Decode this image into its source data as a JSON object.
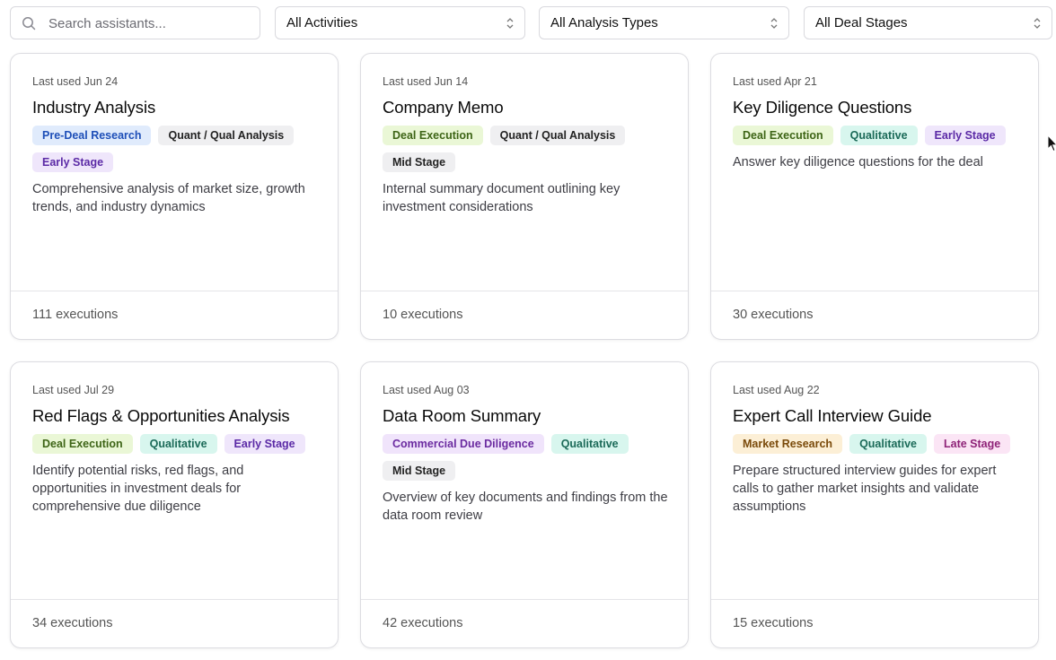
{
  "search": {
    "placeholder": "Search assistants..."
  },
  "filters": {
    "activities": "All Activities",
    "analysis_types": "All Analysis Types",
    "deal_stages": "All Deal Stages"
  },
  "cards": [
    {
      "last_used": "Last used Jun 24",
      "title": "Industry Analysis",
      "tags": [
        {
          "label": "Pre-Deal Research",
          "color": "#1e4fb8"
        },
        {
          "label": "Quant / Qual Analysis",
          "color": "#222222"
        },
        {
          "label": "Early Stage",
          "color": "#5b2aa6"
        }
      ],
      "description": "Comprehensive analysis of market size, growth trends, and industry dynamics",
      "executions": "111 executions"
    },
    {
      "last_used": "Last used Jun 14",
      "title": "Company Memo",
      "tags": [
        {
          "label": "Deal Execution",
          "color": "#3d6416"
        },
        {
          "label": "Quant / Qual Analysis",
          "color": "#222222"
        },
        {
          "label": "Mid Stage",
          "color": "#222222"
        }
      ],
      "description": "Internal summary document outlining key investment considerations",
      "executions": "10 executions"
    },
    {
      "last_used": "Last used Apr 21",
      "title": "Key Diligence Questions",
      "tags": [
        {
          "label": "Deal Execution",
          "color": "#3d6416"
        },
        {
          "label": "Qualitative",
          "color": "#1b6a58"
        },
        {
          "label": "Early Stage",
          "color": "#5b2aa6"
        }
      ],
      "description": "Answer key diligence questions for the deal",
      "executions": "30 executions"
    },
    {
      "last_used": "Last used Jul 29",
      "title": "Red Flags & Opportunities Analysis",
      "tags": [
        {
          "label": "Deal Execution",
          "color": "#3d6416"
        },
        {
          "label": "Qualitative",
          "color": "#1b6a58"
        },
        {
          "label": "Early Stage",
          "color": "#5b2aa6"
        }
      ],
      "description": "Identify potential risks, red flags, and opportunities in investment deals for comprehensive due diligence",
      "executions": "34 executions"
    },
    {
      "last_used": "Last used Aug 03",
      "title": "Data Room Summary",
      "tags": [
        {
          "label": "Commercial Due Diligence",
          "color": "#6b2ba0"
        },
        {
          "label": "Qualitative",
          "color": "#1b6a58"
        },
        {
          "label": "Mid Stage",
          "color": "#222222"
        }
      ],
      "description": "Overview of key documents and findings from the data room review",
      "executions": "42 executions"
    },
    {
      "last_used": "Last used Aug 22",
      "title": "Expert Call Interview Guide",
      "tags": [
        {
          "label": "Market Research",
          "color": "#7a4a0a"
        },
        {
          "label": "Qualitative",
          "color": "#1b6a58"
        },
        {
          "label": "Late Stage",
          "color": "#8f2378"
        }
      ],
      "description": "Prepare structured interview guides for expert calls to gather market insights and validate assumptions",
      "executions": "15 executions"
    }
  ]
}
